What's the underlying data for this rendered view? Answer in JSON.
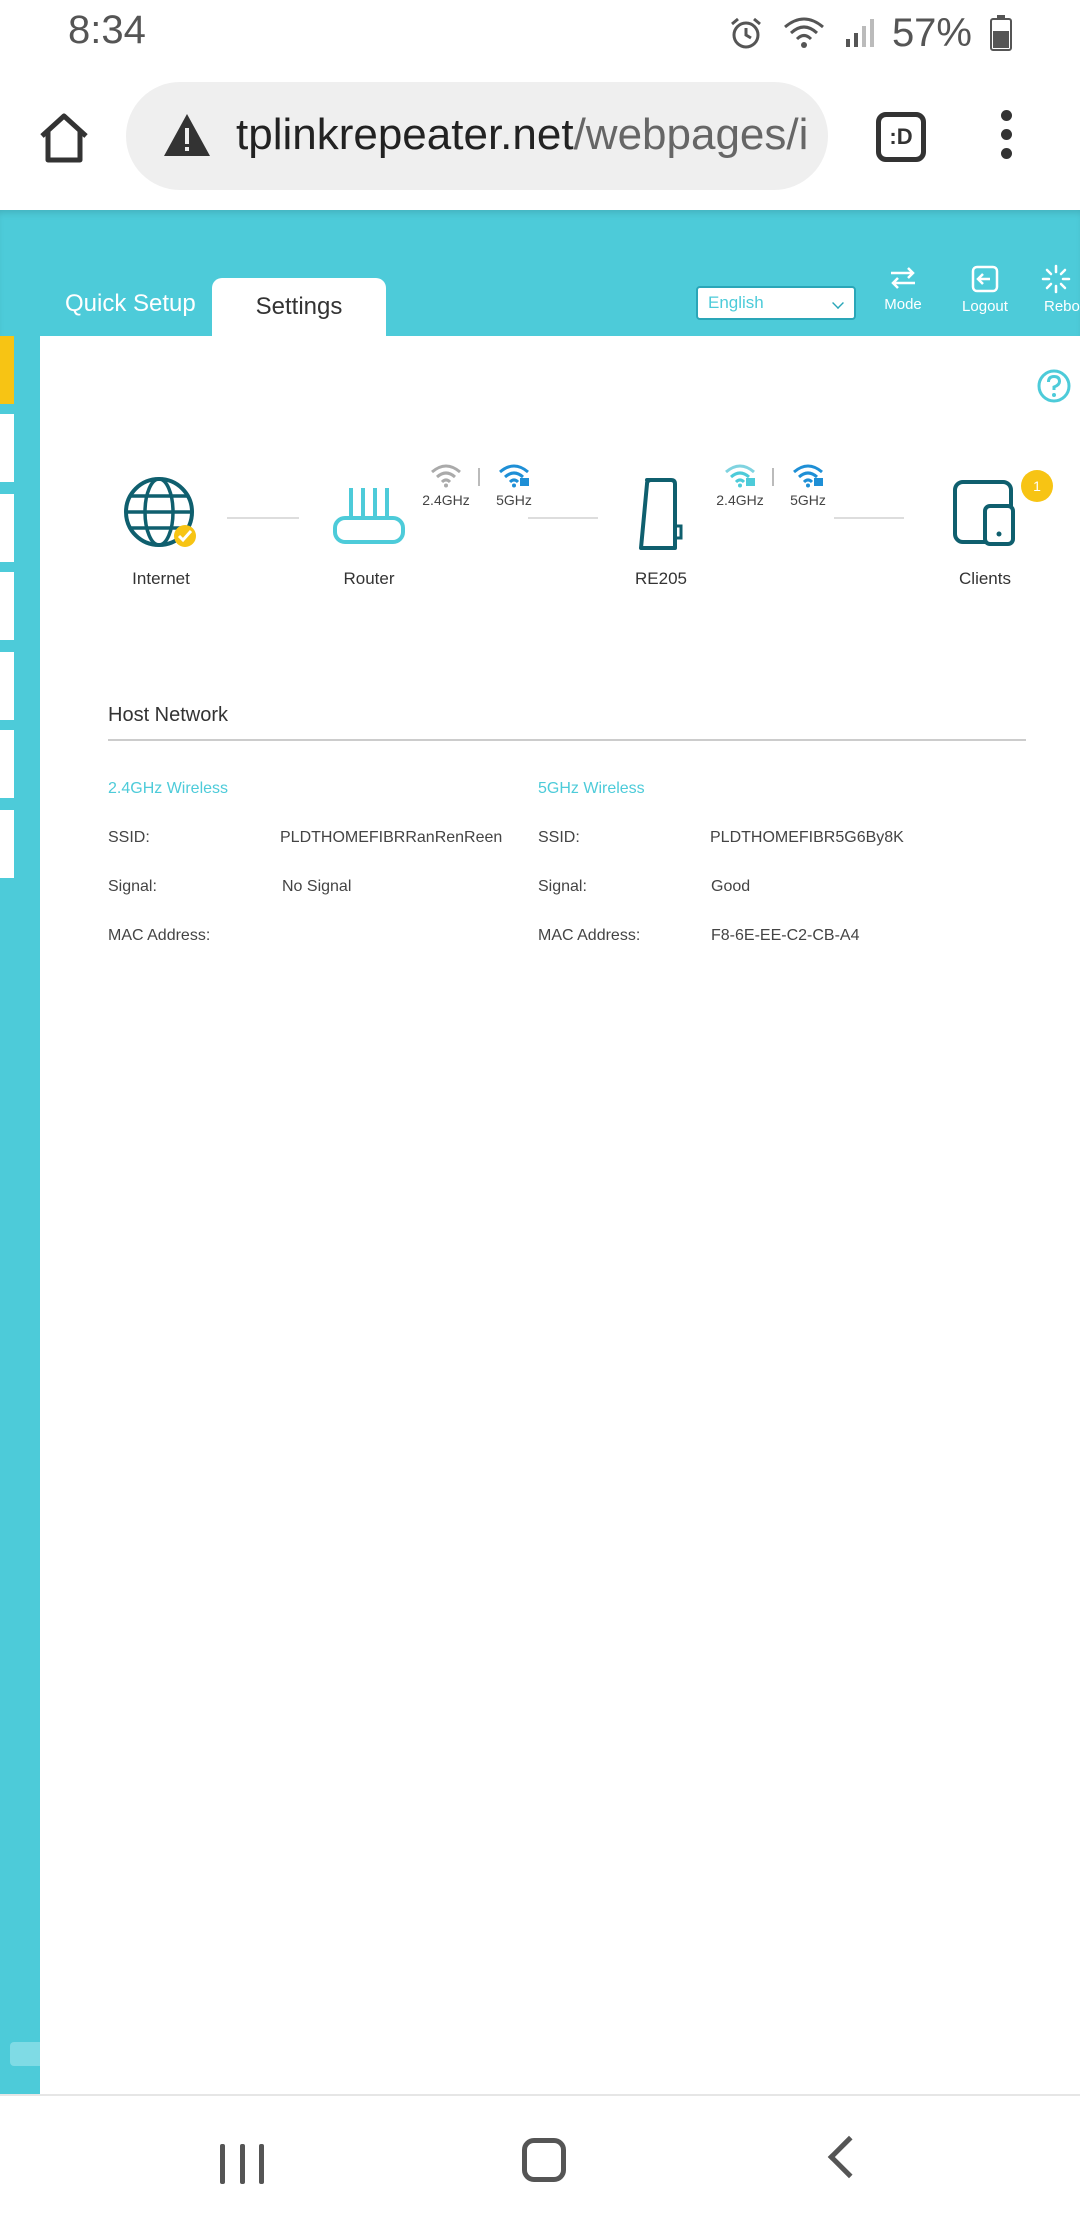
{
  "status": {
    "time": "8:34",
    "battery": "57%"
  },
  "browser": {
    "url_domain": "tplinkrepeater.net",
    "url_path": "/webpages/i",
    "tab_icon": ":D"
  },
  "header": {
    "tabs": [
      {
        "label": "Quick Setup"
      },
      {
        "label": "Settings"
      }
    ],
    "language": "English",
    "buttons": [
      {
        "label": "Mode"
      },
      {
        "label": "Logout"
      },
      {
        "label": "Reboo"
      }
    ]
  },
  "topology": {
    "internet": "Internet",
    "router": "Router",
    "repeater": "RE205",
    "clients": "Clients",
    "clients_count": "1",
    "router_bands": [
      "2.4GHz",
      "5GHz"
    ],
    "repeater_bands": [
      "2.4GHz",
      "5GHz"
    ]
  },
  "host_network": {
    "title": "Host Network",
    "ssid_label": "SSID:",
    "signal_label": "Signal:",
    "mac_label": "MAC Address:",
    "wireless_24": {
      "title": "2.4GHz Wireless",
      "ssid": "PLDTHOMEFIBRRanRenReen",
      "signal": "No Signal",
      "mac": ""
    },
    "wireless_5": {
      "title": "5GHz Wireless",
      "ssid": "PLDTHOMEFIBR5G6By8K",
      "signal": "Good",
      "mac": "F8-6E-EE-C2-CB-A4"
    }
  },
  "colors": {
    "teal": "#4dcbd9",
    "accent_yellow": "#f7c414",
    "dark_teal": "#0f5f6e"
  }
}
